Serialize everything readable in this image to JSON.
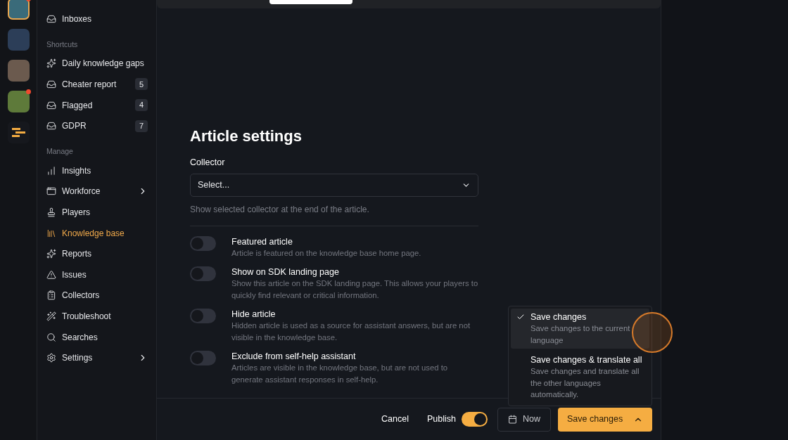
{
  "apps": [
    {
      "selected": true,
      "notification": true
    },
    {
      "selected": false,
      "notification": false
    },
    {
      "selected": false,
      "notification": false
    },
    {
      "selected": false,
      "notification": true
    }
  ],
  "sidebar": {
    "top_items": [
      {
        "label": "Inboxes",
        "selected": false
      }
    ],
    "sections": [
      {
        "title": "Shortcuts",
        "items": [
          {
            "label": "Daily knowledge gaps",
            "selected": false
          },
          {
            "label": "Cheater report",
            "count": "5",
            "selected": false
          },
          {
            "label": "Flagged",
            "count": "4",
            "selected": false
          },
          {
            "label": "GDPR",
            "count": "7",
            "selected": false
          }
        ]
      },
      {
        "title": "Manage",
        "items": [
          {
            "label": "Insights",
            "selected": false
          },
          {
            "label": "Workforce",
            "has_submenu": true,
            "selected": false
          },
          {
            "label": "Players",
            "selected": false
          },
          {
            "label": "Knowledge base",
            "selected": true
          },
          {
            "label": "Reports",
            "selected": false
          },
          {
            "label": "Issues",
            "selected": false
          },
          {
            "label": "Collectors",
            "selected": false
          },
          {
            "label": "Troubleshoot",
            "selected": false
          },
          {
            "label": "Searches",
            "selected": false
          },
          {
            "label": "Settings",
            "has_submenu": true,
            "selected": false
          }
        ]
      }
    ]
  },
  "article_settings": {
    "title": "Article settings",
    "collector": {
      "label": "Collector",
      "placeholder": "Select...",
      "help": "Show selected collector at the end of the article."
    },
    "toggles": [
      {
        "label": "Featured article",
        "description": "Article is featured on the knowledge base home page.",
        "on": false
      },
      {
        "label": "Show on SDK landing page",
        "description": "Show this article on the SDK landing page. This allows your players to quickly find relevant or critical information.",
        "on": false
      },
      {
        "label": "Hide article",
        "description": "Hidden article is used as a source for assistant answers, but are not visible in the knowledge base.",
        "on": false
      },
      {
        "label": "Exclude from self-help assistant",
        "description": "Articles are visible in the knowledge base, but are not used to generate assistant responses in self-help.",
        "on": false
      }
    ]
  },
  "save_menu": {
    "items": [
      {
        "label": "Save changes",
        "description": "Save changes to the current language",
        "selected": true
      },
      {
        "label": "Save changes & translate all",
        "description": "Save changes and translate all the other languages automatically.",
        "selected": false
      }
    ]
  },
  "footer": {
    "cancel": "Cancel",
    "publish": {
      "label": "Publish",
      "on": true
    },
    "schedule": "Now",
    "save": "Save changes"
  }
}
